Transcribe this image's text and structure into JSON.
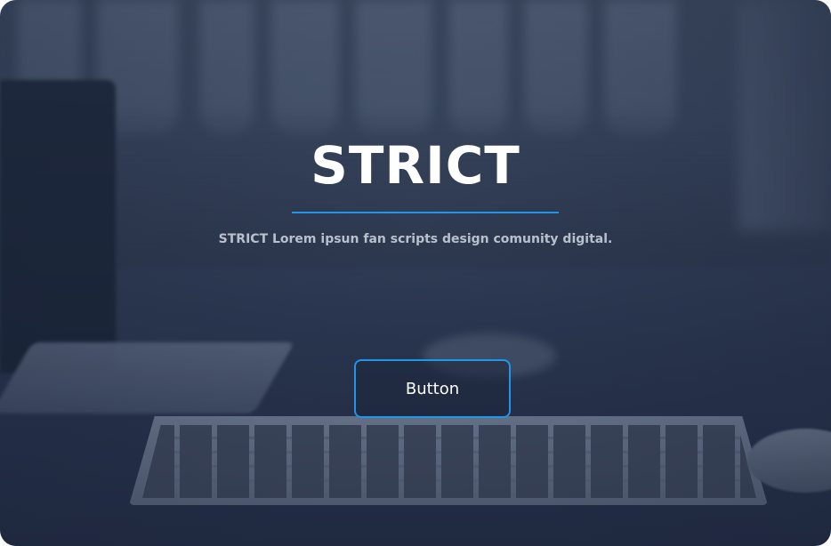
{
  "hero": {
    "title": "STRICT",
    "subtitle": "STRICT Lorem ipsun fan scripts design comunity digital.",
    "button_label": "Button"
  },
  "colors": {
    "accent": "#2196e8",
    "overlay": "#2a3650",
    "title_text": "#ffffff",
    "subtitle_text": "#b9c0cc"
  },
  "background": {
    "image_subject": "blurred desk photo with keyboard and laptop"
  }
}
